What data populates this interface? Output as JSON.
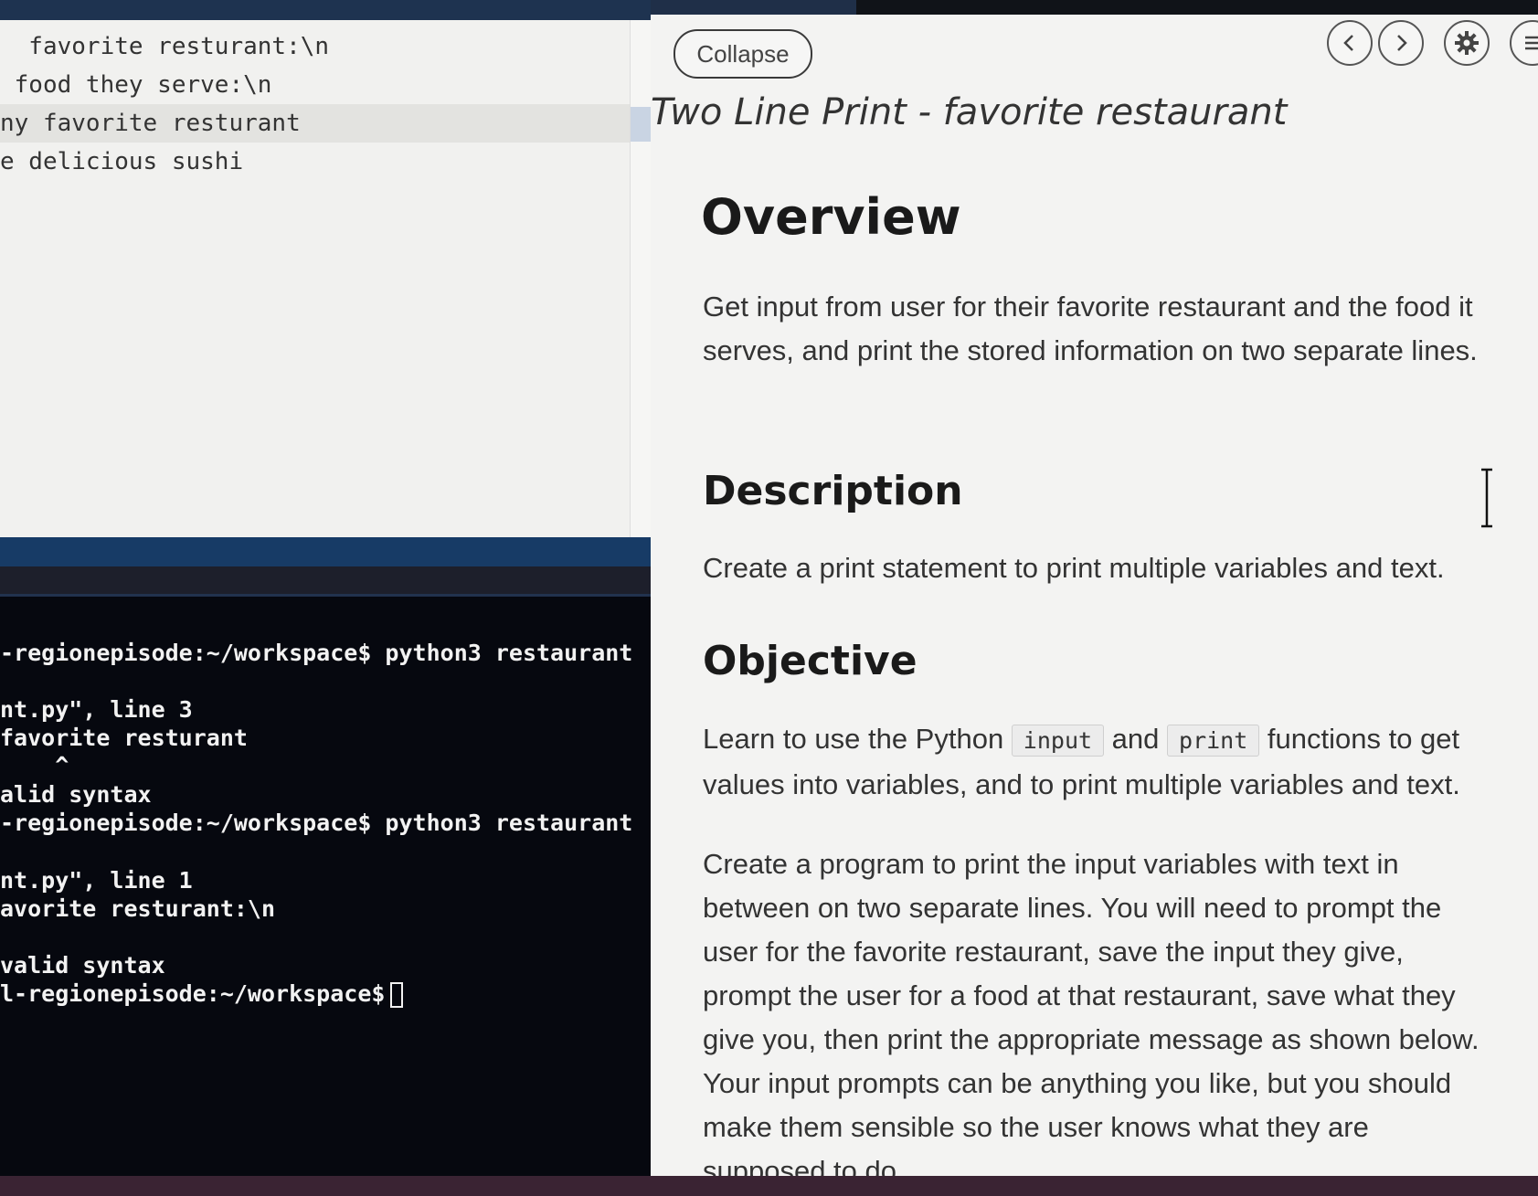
{
  "editor": {
    "lines": [
      "  favorite resturant:\\n",
      " food they serve:\\n",
      "ny favorite resturant",
      "e delicious sushi"
    ]
  },
  "terminal": {
    "lines": [
      "-regionepisode:~/workspace$ python3 restaurant",
      "",
      "nt.py\", line 3",
      "favorite resturant",
      "    ^",
      "alid syntax",
      "-regionepisode:~/workspace$ python3 restaurant",
      "",
      "nt.py\", line 1",
      "avorite resturant:\\n",
      "",
      "valid syntax",
      "l-regionepisode:~/workspace$"
    ]
  },
  "guide": {
    "collapse_label": "Collapse",
    "title": "Two Line Print - favorite restaurant",
    "overview_heading": "Overview",
    "overview_text": "Get input from user for their favorite restaurant and the food it serves, and print the stored information on two separate lines.",
    "description_heading": "Description",
    "description_text": "Create a print statement to print multiple variables and text.",
    "objective_heading": "Objective",
    "objective_pre": "Learn to use the Python ",
    "objective_code1": "input",
    "objective_mid": " and ",
    "objective_code2": "print",
    "objective_post": " functions to get values into variables, and to print multiple variables and text.",
    "program_text": "Create a program to print the input variables with text in between on two separate lines. You will need to prompt the user for the favorite restaurant, save the input they give, prompt the user for a food at that restaurant, save what they give you, then print the appropriate message as shown below. Your input prompts can be anything you like, but you should make them sensible so the user knows what they are supposed to do."
  },
  "icons": {
    "prev": "chevron-left-icon",
    "next": "chevron-right-icon",
    "settings": "gear-icon",
    "menu": "menu-icon"
  }
}
